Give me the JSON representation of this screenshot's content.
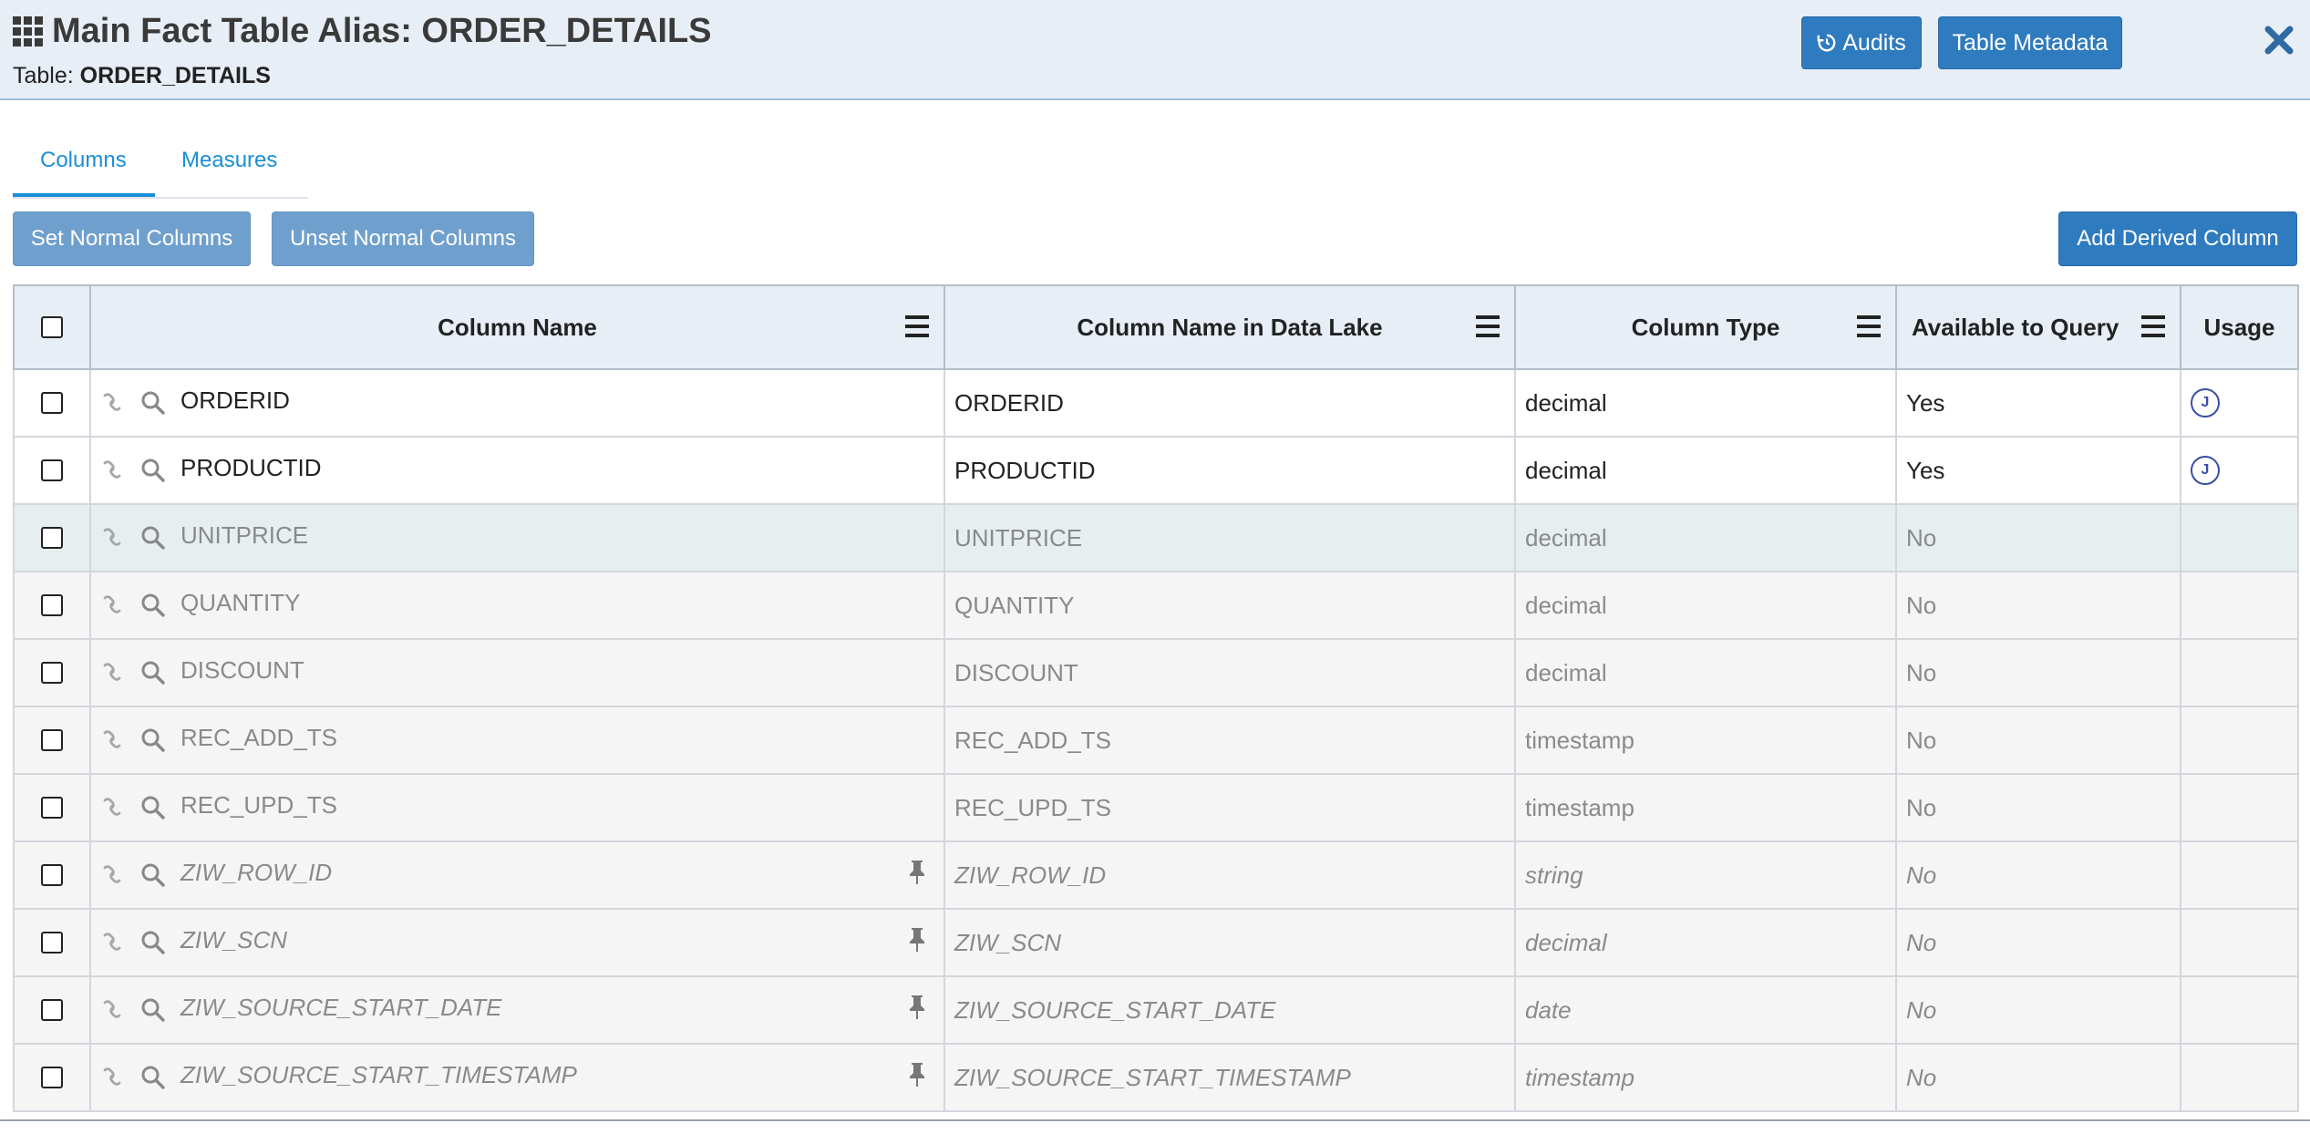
{
  "header": {
    "title": "Main Fact Table Alias: ORDER_DETAILS",
    "table_label": "Table:",
    "table_name": "ORDER_DETAILS",
    "audits_label": "Audits",
    "metadata_label": "Table Metadata"
  },
  "tabs": [
    {
      "label": "Columns",
      "active": true
    },
    {
      "label": "Measures",
      "active": false
    }
  ],
  "actions": {
    "set_normal": "Set Normal Columns",
    "unset_normal": "Unset Normal Columns",
    "add_derived": "Add Derived Column"
  },
  "table": {
    "headers": [
      "Column Name",
      "Column Name in Data Lake",
      "Column Type",
      "Available to Query",
      "Usage"
    ],
    "rows": [
      {
        "name": "ORDERID",
        "lake": "ORDERID",
        "type": "decimal",
        "available": "Yes",
        "usage": "J"
      },
      {
        "name": "PRODUCTID",
        "lake": "PRODUCTID",
        "type": "decimal",
        "available": "Yes",
        "usage": "J"
      },
      {
        "name": "UNITPRICE",
        "lake": "UNITPRICE",
        "type": "decimal",
        "available": "No",
        "usage": ""
      },
      {
        "name": "QUANTITY",
        "lake": "QUANTITY",
        "type": "decimal",
        "available": "No",
        "usage": ""
      },
      {
        "name": "DISCOUNT",
        "lake": "DISCOUNT",
        "type": "decimal",
        "available": "No",
        "usage": ""
      },
      {
        "name": "REC_ADD_TS",
        "lake": "REC_ADD_TS",
        "type": "timestamp",
        "available": "No",
        "usage": ""
      },
      {
        "name": "REC_UPD_TS",
        "lake": "REC_UPD_TS",
        "type": "timestamp",
        "available": "No",
        "usage": ""
      },
      {
        "name": "ZIW_ROW_ID",
        "lake": "ZIW_ROW_ID",
        "type": "string",
        "available": "No",
        "usage": ""
      },
      {
        "name": "ZIW_SCN",
        "lake": "ZIW_SCN",
        "type": "decimal",
        "available": "No",
        "usage": ""
      },
      {
        "name": "ZIW_SOURCE_START_DATE",
        "lake": "ZIW_SOURCE_START_DATE",
        "type": "date",
        "available": "No",
        "usage": ""
      },
      {
        "name": "ZIW_SOURCE_START_TIMESTAMP",
        "lake": "ZIW_SOURCE_START_TIMESTAMP",
        "type": "timestamp",
        "available": "No",
        "usage": ""
      }
    ]
  },
  "colors": {
    "primary_button": "#2f7bbf",
    "secondary_button": "#6f9fcd",
    "header_bg": "#e8eef6",
    "tab_active": "#1a8fd6"
  }
}
